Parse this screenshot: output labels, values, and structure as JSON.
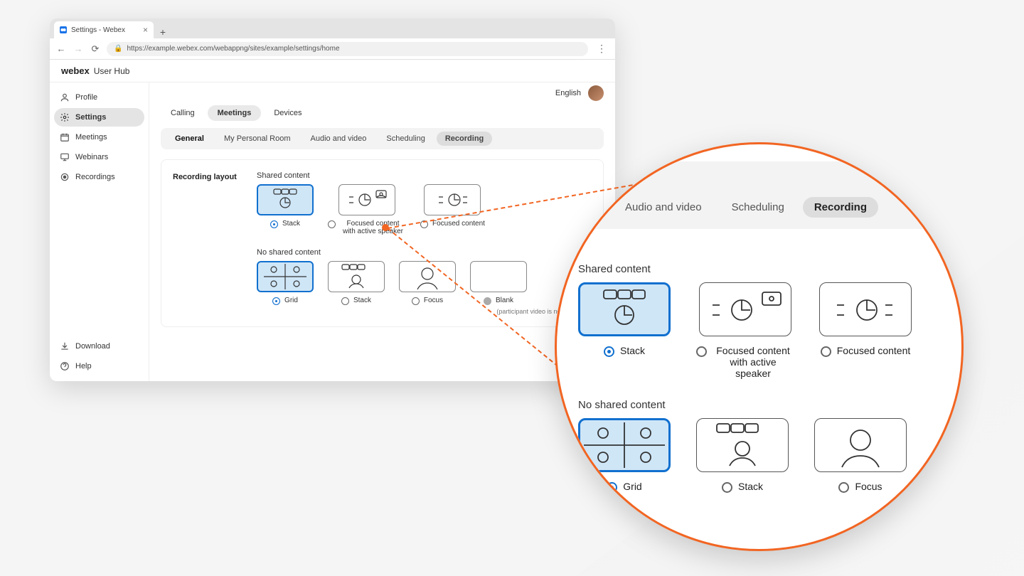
{
  "browser": {
    "tab_title": "Settings - Webex",
    "url": "https://example.webex.com/webappng/sites/example/settings/home"
  },
  "app": {
    "brand": "webex",
    "brand_sub": "User Hub",
    "language": "English"
  },
  "sidebar": {
    "items": [
      {
        "label": "Profile"
      },
      {
        "label": "Settings"
      },
      {
        "label": "Meetings"
      },
      {
        "label": "Webinars"
      },
      {
        "label": "Recordings"
      }
    ],
    "footer": [
      {
        "label": "Download"
      },
      {
        "label": "Help"
      }
    ]
  },
  "tabs_primary": [
    "Calling",
    "Meetings",
    "Devices"
  ],
  "tabs_secondary": [
    "General",
    "My Personal Room",
    "Audio and video",
    "Scheduling",
    "Recording"
  ],
  "panel": {
    "title": "Recording layout",
    "shared_title": "Shared content",
    "noshared_title": "No shared content",
    "shared_options": [
      "Stack",
      "Focused content with active speaker",
      "Focused content"
    ],
    "noshared_options": [
      "Grid",
      "Stack",
      "Focus",
      "Blank"
    ],
    "blank_note": "(participant video is not recorded)"
  },
  "magnifier": {
    "tabs": [
      "Audio and video",
      "Scheduling",
      "Recording"
    ],
    "shared_title": "Shared content",
    "noshared_title": "No shared content",
    "shared_options": [
      "Stack",
      "Focused content with active speaker",
      "Focused content"
    ],
    "noshared_options": [
      "Grid",
      "Stack",
      "Focus"
    ]
  }
}
